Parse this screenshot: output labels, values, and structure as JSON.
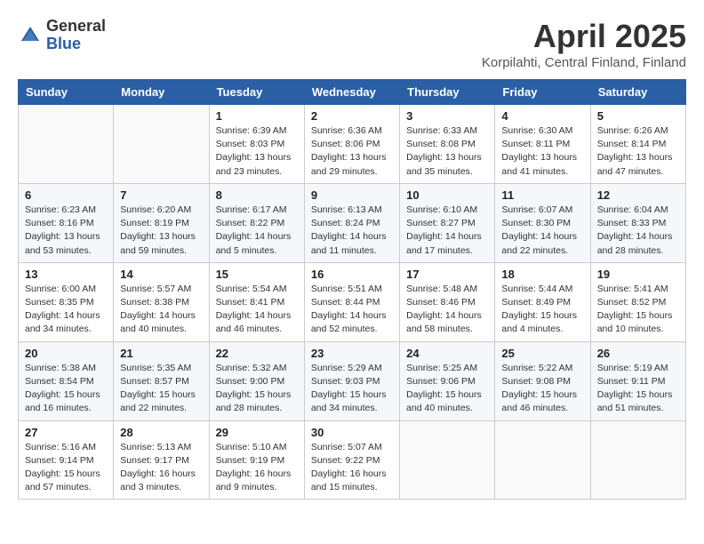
{
  "logo": {
    "general": "General",
    "blue": "Blue"
  },
  "title": "April 2025",
  "subtitle": "Korpilahti, Central Finland, Finland",
  "weekdays": [
    "Sunday",
    "Monday",
    "Tuesday",
    "Wednesday",
    "Thursday",
    "Friday",
    "Saturday"
  ],
  "weeks": [
    [
      {
        "day": "",
        "info": ""
      },
      {
        "day": "",
        "info": ""
      },
      {
        "day": "1",
        "info": "Sunrise: 6:39 AM\nSunset: 8:03 PM\nDaylight: 13 hours\nand 23 minutes."
      },
      {
        "day": "2",
        "info": "Sunrise: 6:36 AM\nSunset: 8:06 PM\nDaylight: 13 hours\nand 29 minutes."
      },
      {
        "day": "3",
        "info": "Sunrise: 6:33 AM\nSunset: 8:08 PM\nDaylight: 13 hours\nand 35 minutes."
      },
      {
        "day": "4",
        "info": "Sunrise: 6:30 AM\nSunset: 8:11 PM\nDaylight: 13 hours\nand 41 minutes."
      },
      {
        "day": "5",
        "info": "Sunrise: 6:26 AM\nSunset: 8:14 PM\nDaylight: 13 hours\nand 47 minutes."
      }
    ],
    [
      {
        "day": "6",
        "info": "Sunrise: 6:23 AM\nSunset: 8:16 PM\nDaylight: 13 hours\nand 53 minutes."
      },
      {
        "day": "7",
        "info": "Sunrise: 6:20 AM\nSunset: 8:19 PM\nDaylight: 13 hours\nand 59 minutes."
      },
      {
        "day": "8",
        "info": "Sunrise: 6:17 AM\nSunset: 8:22 PM\nDaylight: 14 hours\nand 5 minutes."
      },
      {
        "day": "9",
        "info": "Sunrise: 6:13 AM\nSunset: 8:24 PM\nDaylight: 14 hours\nand 11 minutes."
      },
      {
        "day": "10",
        "info": "Sunrise: 6:10 AM\nSunset: 8:27 PM\nDaylight: 14 hours\nand 17 minutes."
      },
      {
        "day": "11",
        "info": "Sunrise: 6:07 AM\nSunset: 8:30 PM\nDaylight: 14 hours\nand 22 minutes."
      },
      {
        "day": "12",
        "info": "Sunrise: 6:04 AM\nSunset: 8:33 PM\nDaylight: 14 hours\nand 28 minutes."
      }
    ],
    [
      {
        "day": "13",
        "info": "Sunrise: 6:00 AM\nSunset: 8:35 PM\nDaylight: 14 hours\nand 34 minutes."
      },
      {
        "day": "14",
        "info": "Sunrise: 5:57 AM\nSunset: 8:38 PM\nDaylight: 14 hours\nand 40 minutes."
      },
      {
        "day": "15",
        "info": "Sunrise: 5:54 AM\nSunset: 8:41 PM\nDaylight: 14 hours\nand 46 minutes."
      },
      {
        "day": "16",
        "info": "Sunrise: 5:51 AM\nSunset: 8:44 PM\nDaylight: 14 hours\nand 52 minutes."
      },
      {
        "day": "17",
        "info": "Sunrise: 5:48 AM\nSunset: 8:46 PM\nDaylight: 14 hours\nand 58 minutes."
      },
      {
        "day": "18",
        "info": "Sunrise: 5:44 AM\nSunset: 8:49 PM\nDaylight: 15 hours\nand 4 minutes."
      },
      {
        "day": "19",
        "info": "Sunrise: 5:41 AM\nSunset: 8:52 PM\nDaylight: 15 hours\nand 10 minutes."
      }
    ],
    [
      {
        "day": "20",
        "info": "Sunrise: 5:38 AM\nSunset: 8:54 PM\nDaylight: 15 hours\nand 16 minutes."
      },
      {
        "day": "21",
        "info": "Sunrise: 5:35 AM\nSunset: 8:57 PM\nDaylight: 15 hours\nand 22 minutes."
      },
      {
        "day": "22",
        "info": "Sunrise: 5:32 AM\nSunset: 9:00 PM\nDaylight: 15 hours\nand 28 minutes."
      },
      {
        "day": "23",
        "info": "Sunrise: 5:29 AM\nSunset: 9:03 PM\nDaylight: 15 hours\nand 34 minutes."
      },
      {
        "day": "24",
        "info": "Sunrise: 5:25 AM\nSunset: 9:06 PM\nDaylight: 15 hours\nand 40 minutes."
      },
      {
        "day": "25",
        "info": "Sunrise: 5:22 AM\nSunset: 9:08 PM\nDaylight: 15 hours\nand 46 minutes."
      },
      {
        "day": "26",
        "info": "Sunrise: 5:19 AM\nSunset: 9:11 PM\nDaylight: 15 hours\nand 51 minutes."
      }
    ],
    [
      {
        "day": "27",
        "info": "Sunrise: 5:16 AM\nSunset: 9:14 PM\nDaylight: 15 hours\nand 57 minutes."
      },
      {
        "day": "28",
        "info": "Sunrise: 5:13 AM\nSunset: 9:17 PM\nDaylight: 16 hours\nand 3 minutes."
      },
      {
        "day": "29",
        "info": "Sunrise: 5:10 AM\nSunset: 9:19 PM\nDaylight: 16 hours\nand 9 minutes."
      },
      {
        "day": "30",
        "info": "Sunrise: 5:07 AM\nSunset: 9:22 PM\nDaylight: 16 hours\nand 15 minutes."
      },
      {
        "day": "",
        "info": ""
      },
      {
        "day": "",
        "info": ""
      },
      {
        "day": "",
        "info": ""
      }
    ]
  ]
}
